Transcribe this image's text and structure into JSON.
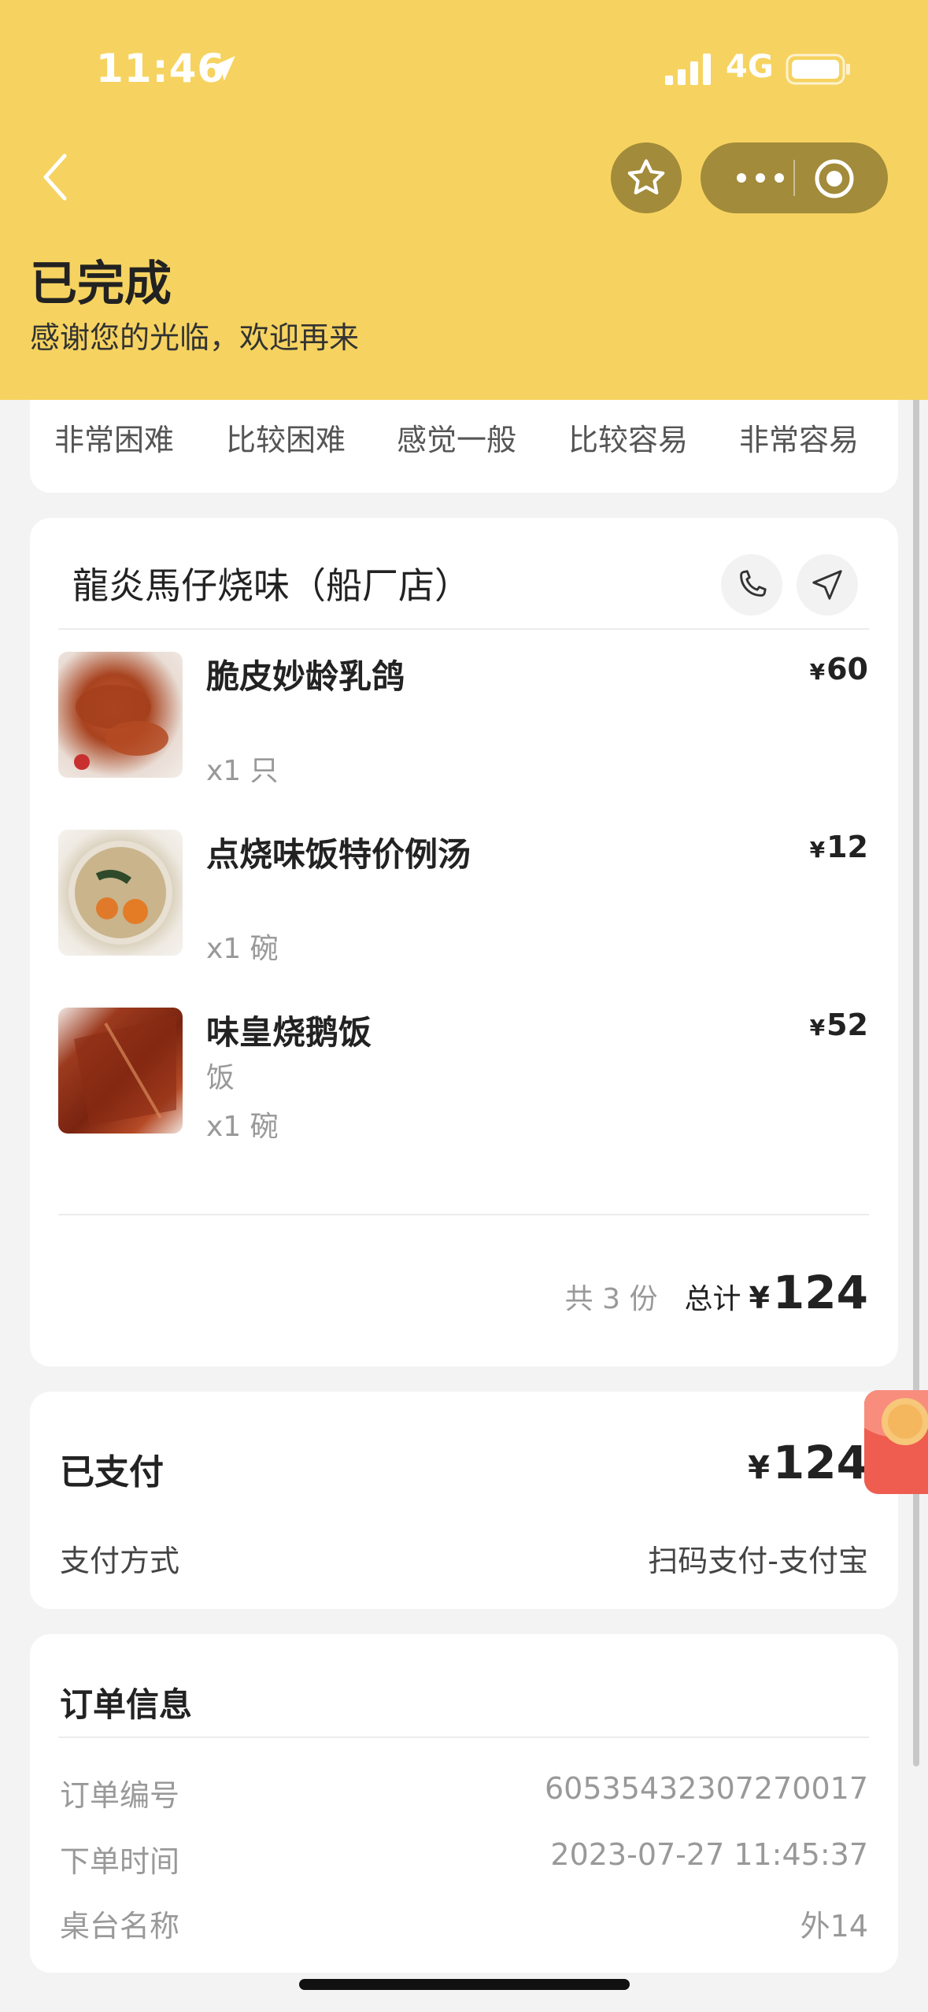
{
  "status_bar": {
    "time": "11:46",
    "network": "4G"
  },
  "header": {
    "title": "已完成",
    "subtitle": "感谢您的光临，欢迎再来",
    "bg_color": "#f6d360"
  },
  "rating": {
    "options": [
      "非常困难",
      "比较困难",
      "感觉一般",
      "比较容易",
      "非常容易"
    ]
  },
  "order": {
    "shop_name": "龍炎馬仔烧味（船厂店）",
    "items": [
      {
        "name": "脆皮妙龄乳鸽",
        "yen": "¥",
        "price": "60",
        "spec": "",
        "qty": "x1 只"
      },
      {
        "name": "点烧味饭特价例汤",
        "yen": "¥",
        "price": "12",
        "spec": "",
        "qty": "x1 碗"
      },
      {
        "name": "味皇烧鹅饭",
        "yen": "¥",
        "price": "52",
        "spec": "饭",
        "qty": "x1 碗"
      }
    ],
    "count_text": "共 3 份",
    "total_label": "总计",
    "total_yen": "¥",
    "total": "124"
  },
  "payment": {
    "title": "已支付",
    "yen": "¥",
    "amount": "124",
    "method_label": "支付方式",
    "method_value": "扫码支付-支付宝"
  },
  "order_info": {
    "title": "订单信息",
    "rows": [
      {
        "label": "订单编号",
        "value": "60535432307270017"
      },
      {
        "label": "下单时间",
        "value": "2023-07-27 11:45:37"
      },
      {
        "label": "桌台名称",
        "value": "外14"
      }
    ]
  },
  "icons": [
    "back-icon",
    "star-icon",
    "more-icon",
    "target-icon",
    "phone-icon",
    "navigate-icon",
    "redpacket-icon"
  ]
}
